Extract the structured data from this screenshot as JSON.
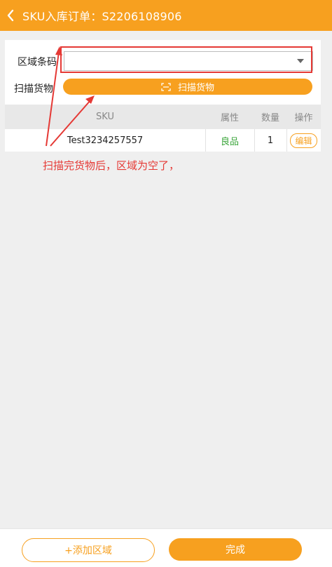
{
  "header": {
    "title": "SKU入库订单：S2206108906",
    "back_icon": "chevron-left-icon"
  },
  "form": {
    "area_label": "区域条码",
    "area_value": "",
    "scan_label": "扫描货物",
    "scan_button_label": "扫描货物",
    "scan_icon": "scan-icon"
  },
  "table": {
    "headers": {
      "sku": "SKU",
      "attribute": "属性",
      "quantity": "数量",
      "action": "操作"
    },
    "rows": [
      {
        "sku": "Test3234257557",
        "attribute": "良品",
        "quantity": "1",
        "action": "编辑"
      }
    ]
  },
  "annotation": {
    "text": "扫描完货物后，区域为空了，"
  },
  "footer": {
    "add_area_label": "+添加区域",
    "done_label": "完成"
  },
  "colors": {
    "accent": "#f7a01f",
    "good_status": "#3aa53a",
    "annotation": "#e53935"
  }
}
